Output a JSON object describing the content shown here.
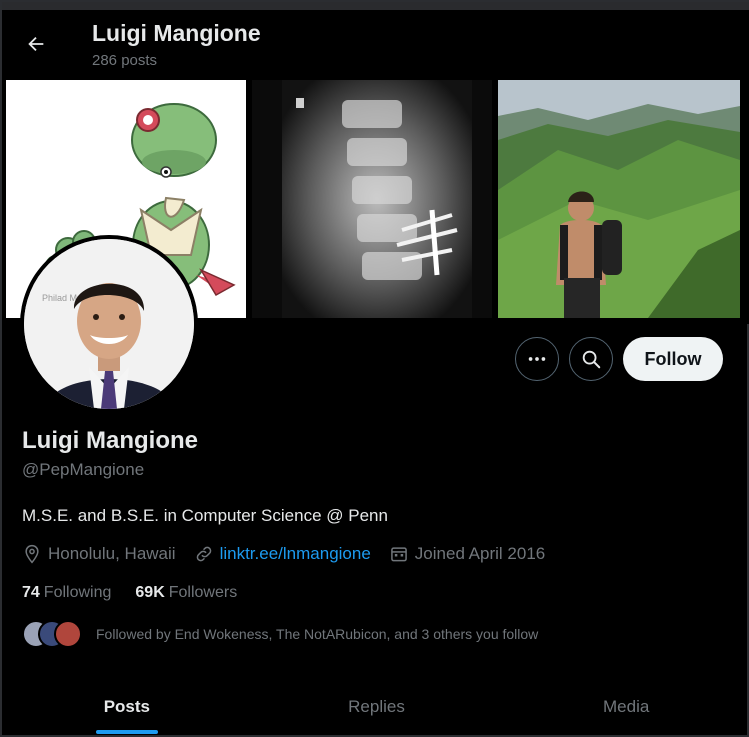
{
  "header": {
    "title": "Luigi Mangione",
    "post_count": "286 posts"
  },
  "profile": {
    "name": "Luigi Mangione",
    "handle": "@PepMangione",
    "bio": "M.S.E. and B.S.E. in Computer Science @ Penn",
    "location": "Honolulu, Hawaii",
    "website": "linktr.ee/lnmangione",
    "joined": "Joined April 2016",
    "following_count": "74",
    "following_label": "Following",
    "followers_count": "69K",
    "followers_label": "Followers",
    "followed_by": "Followed by End Wokeness, The NotARubicon, and 3 others you follow"
  },
  "avatar_sign_text": "Philad Muse",
  "actions": {
    "follow_label": "Follow"
  },
  "tabs": [
    {
      "label": "Posts",
      "active": true
    },
    {
      "label": "Replies",
      "active": false
    },
    {
      "label": "Media",
      "active": false
    }
  ],
  "icons": {
    "back": "arrow-left-icon",
    "more": "more-dots-icon",
    "search": "search-icon",
    "location": "location-pin-icon",
    "link": "link-icon",
    "calendar": "calendar-icon"
  },
  "colors": {
    "background": "#000000",
    "accent": "#1d9bf0",
    "muted": "#71767b",
    "text": "#e7e9ea",
    "follow_bg": "#eff3f4"
  }
}
